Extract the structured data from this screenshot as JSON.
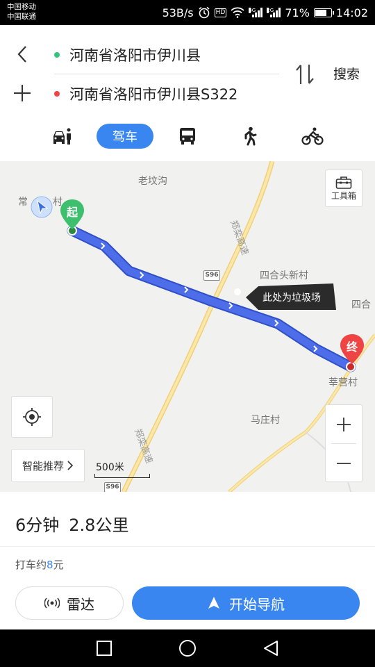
{
  "status_bar": {
    "carrier_1": "中国移动",
    "carrier_2": "中国联通",
    "net_speed": "53B/s",
    "hd_badge": "HD",
    "sig1_tag": "4G",
    "sig2_tag": "2G",
    "battery_percent": "71%",
    "battery_level": 0.71,
    "time": "14:02"
  },
  "route": {
    "start": "河南省洛阳市伊川县",
    "end": "河南省洛阳市伊川县S322",
    "start_dot_color": "#33c47a",
    "end_dot_color": "#ef4444",
    "search_label": "搜索"
  },
  "modes": {
    "taxi_icon": "car-pedestrian-icon",
    "drive_label": "驾车",
    "bus_icon": "bus-icon",
    "walk_icon": "walk-icon",
    "bike_icon": "bike-icon"
  },
  "map": {
    "labels": {
      "laowengou": "老坟沟",
      "changshan": "常",
      "changshan_cun": "村",
      "siheitou": "四合头新村",
      "sihe": "四合",
      "xinying": "莘营村",
      "mazhuang": "马庄村",
      "highway_upper": "郑栾高速",
      "highway_lower": "郑栾高速"
    },
    "shield_upper": "S96",
    "shield_lower": "S96",
    "toolbox_label": "工具箱",
    "callout_text": "此处为垃圾场",
    "start_pin_label": "起",
    "end_pin_label": "终",
    "smart_recommend_label": "智能推荐",
    "scale_label": "500米",
    "route_color": "#4d6ee8",
    "start_pin_color": "#3dbf6e",
    "end_pin_color": "#ef4444"
  },
  "summary": {
    "duration": "6分钟",
    "distance": "2.8公里",
    "taxi_prefix": "打车约",
    "taxi_price": "8",
    "taxi_suffix": "元",
    "radar_label": "雷达",
    "navigate_label": "开始导航",
    "accent": "#3a86f0"
  },
  "system_nav": {
    "recent_icon": "square-icon",
    "home_icon": "circle-icon",
    "back_icon": "triangle-back-icon"
  }
}
